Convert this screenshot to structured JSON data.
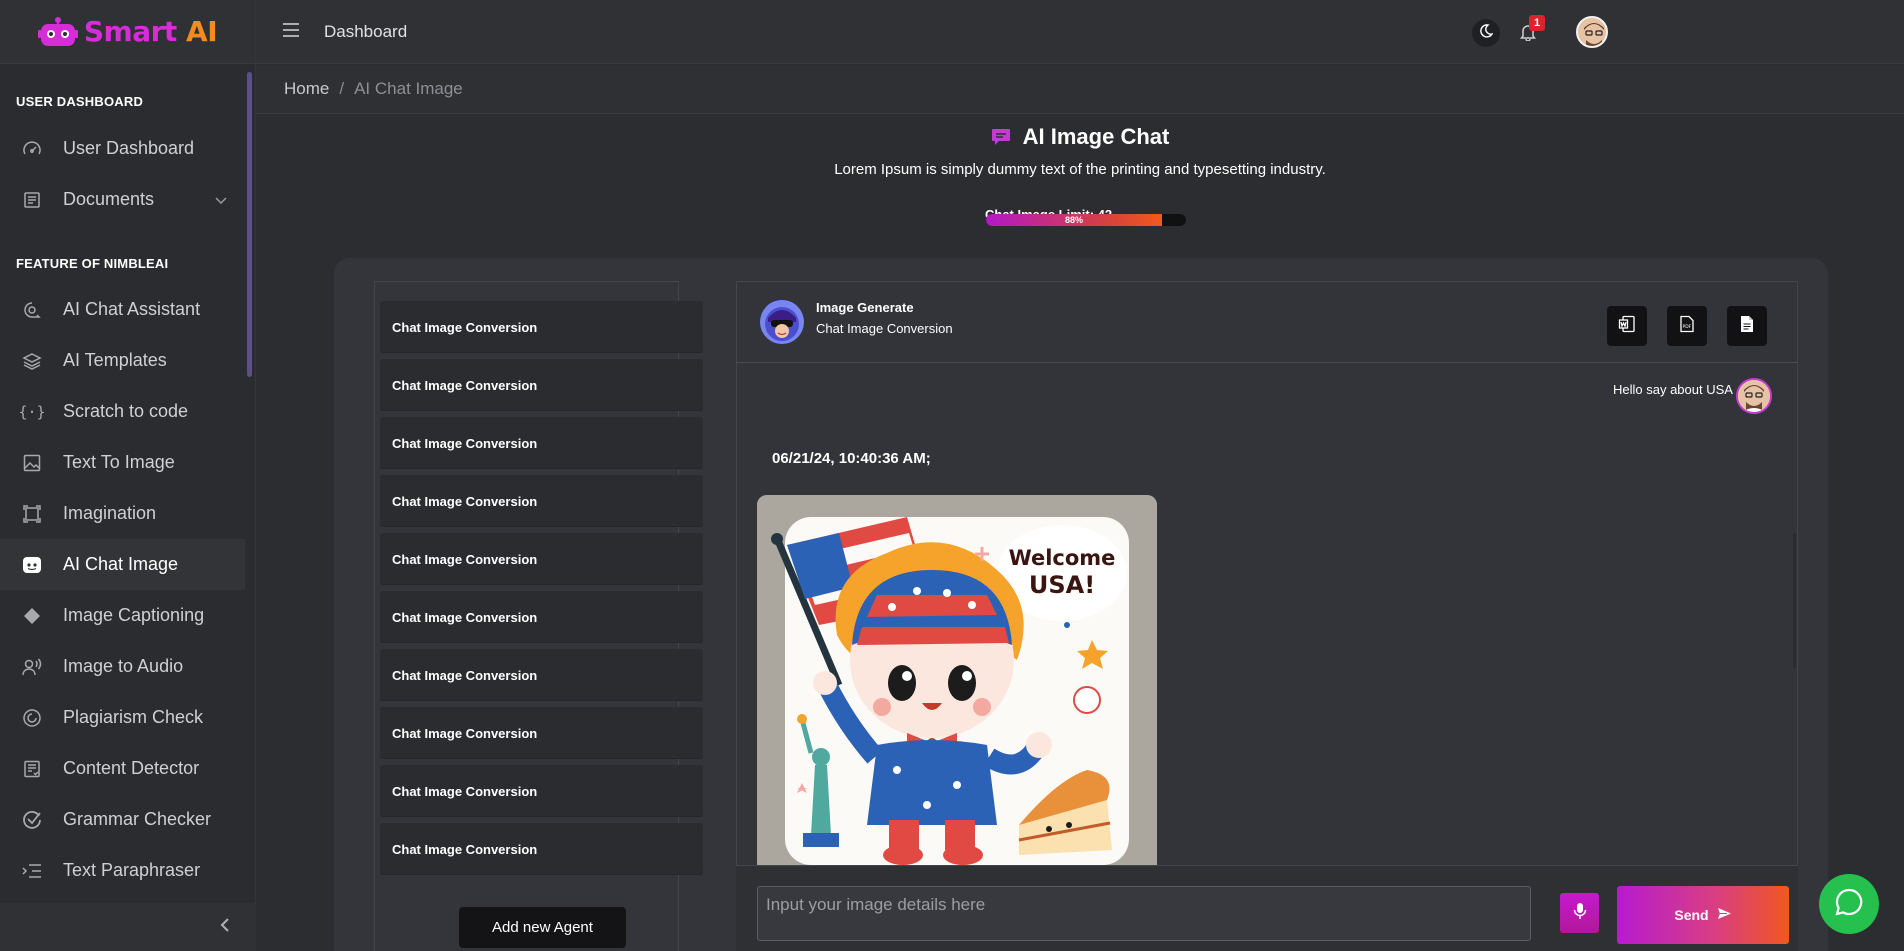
{
  "app": {
    "logo_word1": "Smart",
    "logo_word2": "AI"
  },
  "topbar": {
    "title": "Dashboard",
    "notification_count": "1"
  },
  "breadcrumb": {
    "home": "Home",
    "separator": "/",
    "current": "AI Chat Image"
  },
  "sidebar": {
    "section1": "USER DASHBOARD",
    "section2": "FEATURE OF NIMBLEAI",
    "items": [
      {
        "label": "User Dashboard",
        "icon": "gauge-icon"
      },
      {
        "label": "Documents",
        "icon": "document-icon"
      },
      {
        "label": "AI Chat Assistant",
        "icon": "chat-search-icon"
      },
      {
        "label": "AI Templates",
        "icon": "layers-icon"
      },
      {
        "label": "Scratch to code",
        "icon": "code-braces-icon"
      },
      {
        "label": "Text To Image",
        "icon": "image-icon"
      },
      {
        "label": "Imagination",
        "icon": "frame-icon"
      },
      {
        "label": "AI Chat Image",
        "icon": "discord-icon"
      },
      {
        "label": "Image Captioning",
        "icon": "diamond-icon"
      },
      {
        "label": "Image to Audio",
        "icon": "voice-icon"
      },
      {
        "label": "Plagiarism Check",
        "icon": "spiral-icon"
      },
      {
        "label": "Content Detector",
        "icon": "report-icon"
      },
      {
        "label": "Grammar Checker",
        "icon": "check-circle-icon"
      },
      {
        "label": "Text Paraphraser",
        "icon": "list-indent-icon"
      }
    ]
  },
  "page": {
    "title": "AI Image Chat",
    "subtitle": "Lorem Ipsum is simply dummy text of the printing and typesetting industry.",
    "limit_label": "Chat Image Limit: 42",
    "limit_percent_text": "88%",
    "limit_fraction": 0.88
  },
  "conversations": {
    "items": [
      "Chat Image Conversion",
      "Chat Image Conversion",
      "Chat Image Conversion",
      "Chat Image Conversion",
      "Chat Image Conversion",
      "Chat Image Conversion",
      "Chat Image Conversion",
      "Chat Image Conversion",
      "Chat Image Conversion",
      "Chat Image Conversion"
    ],
    "add_button": "Add new Agent"
  },
  "chat": {
    "name": "Image Generate",
    "subtitle": "Chat Image Conversion",
    "user_message": "Hello say about USA",
    "timestamp": "06/21/24, 10:40:36 AM;",
    "image_text_line1": "Welcome",
    "image_text_line2": "USA!",
    "input_placeholder": "Input your image details here",
    "send_label": "Send"
  },
  "colors": {
    "accent_purple": "#c53bd1",
    "accent_orange": "#f0581e",
    "whatsapp_green": "#26c04f"
  }
}
